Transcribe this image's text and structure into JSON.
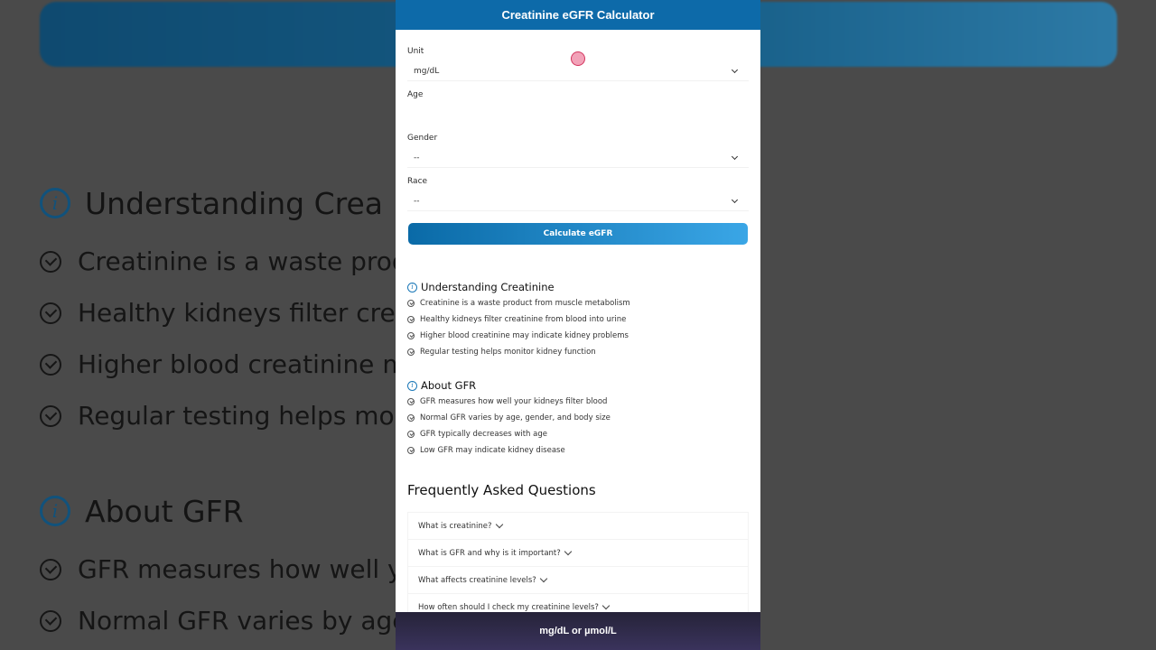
{
  "background": {
    "sections": [
      {
        "title": "Understanding Crea",
        "items": [
          "Creatinine is a waste produ",
          "Healthy kidneys filter creat",
          "Higher blood creatinine ma",
          "Regular testing helps mon"
        ]
      },
      {
        "title": "About GFR",
        "items": [
          "GFR measures how well yo",
          "Normal GFR varies by age,"
        ]
      }
    ]
  },
  "app": {
    "title": "Creatinine eGFR Calculator",
    "form": {
      "unit_label": "Unit",
      "unit_value": "mg/dL",
      "age_label": "Age",
      "age_value": "",
      "gender_label": "Gender",
      "gender_value": "--",
      "race_label": "Race",
      "race_value": "--",
      "calculate_label": "Calculate eGFR"
    },
    "info_sections": [
      {
        "title": "Understanding Creatinine",
        "items": [
          "Creatinine is a waste product from muscle metabolism",
          "Healthy kidneys filter creatinine from blood into urine",
          "Higher blood creatinine may indicate kidney problems",
          "Regular testing helps monitor kidney function"
        ]
      },
      {
        "title": "About GFR",
        "items": [
          "GFR measures how well your kidneys filter blood",
          "Normal GFR varies by age, gender, and body size",
          "GFR typically decreases with age",
          "Low GFR may indicate kidney disease"
        ]
      }
    ],
    "faq": {
      "title": "Frequently Asked Questions",
      "items": [
        "What is creatinine?",
        "What is GFR and why is it important?",
        "What affects creatinine levels?",
        "How often should I check my creatinine levels?"
      ]
    },
    "caption": "mg/dL or µmol/L"
  },
  "colors": {
    "header": "#0d6aa9",
    "button_start": "#0a6aa7",
    "button_end": "#3aa6e6",
    "caption_bar": "#2e2a48"
  }
}
